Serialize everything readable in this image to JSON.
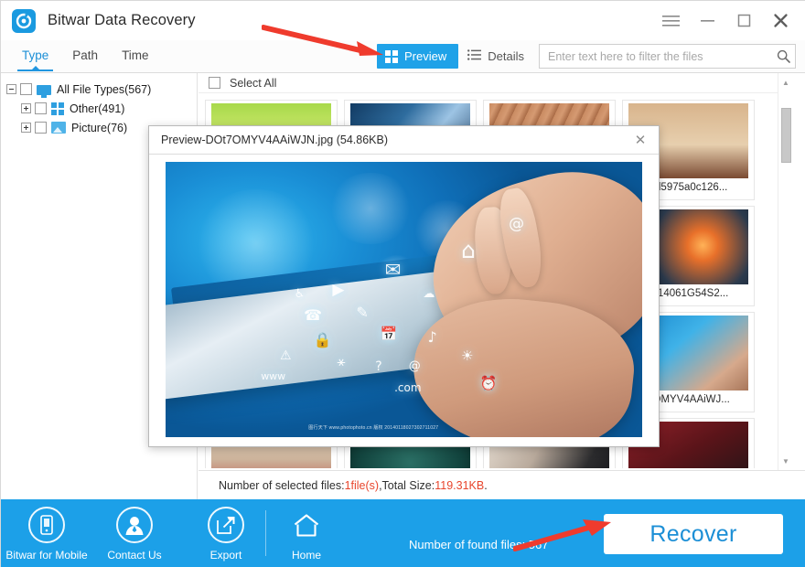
{
  "window": {
    "title": "Bitwar Data Recovery",
    "logo_icon": "bitwar-refresh-logo",
    "controls": [
      {
        "name": "menu",
        "icon": "hamburger-icon",
        "glyph": "☰"
      },
      {
        "name": "minimize",
        "icon": "minimize-icon",
        "glyph": "—"
      },
      {
        "name": "maximize",
        "icon": "maximize-icon",
        "glyph": "□"
      },
      {
        "name": "close",
        "icon": "close-icon",
        "glyph": "✕"
      }
    ]
  },
  "tabs": [
    {
      "label": "Type",
      "active": true
    },
    {
      "label": "Path",
      "active": false
    },
    {
      "label": "Time",
      "active": false
    }
  ],
  "toolbar": {
    "preview_label": "Preview",
    "preview_icon": "grid-view-icon",
    "details_label": "Details",
    "details_icon": "list-view-icon",
    "search_placeholder": "Enter text here to filter the files",
    "search_value": "",
    "search_icon": "search-icon",
    "accent_color": "#1fa2e8"
  },
  "tree": [
    {
      "label": "All File Types(567)",
      "level": 1,
      "icon": "monitor-icon",
      "expander": "minus",
      "checked": false
    },
    {
      "label": "Other(491)",
      "level": 2,
      "icon": "other-files-icon",
      "expander": "plus",
      "checked": false
    },
    {
      "label": "Picture(76)",
      "level": 2,
      "icon": "picture-icon",
      "expander": "plus",
      "checked": false
    }
  ],
  "file_grid": {
    "select_all_label": "Select All",
    "select_all_checked": false,
    "items": [
      {
        "name": "",
        "thumb": "grass-field"
      },
      {
        "name": "",
        "thumb": "skyscrapers"
      },
      {
        "name": "",
        "thumb": "brick-corridor"
      },
      {
        "name": "5d5975a0c126...",
        "thumb": "bread-board"
      },
      {
        "name": "",
        "thumb": "hands-device"
      },
      {
        "name": "",
        "thumb": "desk-laptop"
      },
      {
        "name": "",
        "thumb": "maze-pattern"
      },
      {
        "name": "0-14061G54S2...",
        "thumb": "bokeh-lights"
      },
      {
        "name": "",
        "thumb": "dark-scene"
      },
      {
        "name": "",
        "thumb": "blue-abstract"
      },
      {
        "name": "",
        "thumb": "office-desk"
      },
      {
        "name": "7OMYV4AAiWJ...",
        "thumb": "tablet-hands-blue"
      },
      {
        "name": "",
        "thumb": "red-ornaments"
      },
      {
        "name": "",
        "thumb": "teal-clock"
      },
      {
        "name": "",
        "thumb": "phones-flatlay"
      },
      {
        "name": "",
        "thumb": "red-phone"
      }
    ]
  },
  "status": {
    "prefix": "Number of selected files: ",
    "count": "1file(s)",
    "middle": " ,Total Size: ",
    "size": "119.31KB",
    "suffix": "."
  },
  "scrollbar": {
    "up_glyph": "▲",
    "down_glyph": "▼"
  },
  "preview_dialog": {
    "title": "Preview-DOt7OMYV4AAiWJN.jpg (54.86KB)",
    "close_glyph": "✕",
    "image_alt": "hands-holding-tablet-with-app-icons",
    "watermark": "图行天下  www.photophoto.cn  版权 20140118027302711027",
    "glyphs": [
      "✉",
      "⌂",
      "✎",
      "☎",
      "▶",
      "♪",
      "☁",
      "⚿",
      "ⓘ",
      "@",
      "?",
      ".com",
      "www"
    ]
  },
  "bottom_bar": {
    "background": "#1ca0e8",
    "items": [
      {
        "label": "Bitwar for Mobile",
        "icon": "mobile-phone-icon"
      },
      {
        "label": "Contact Us",
        "icon": "person-icon"
      },
      {
        "label": "Export",
        "icon": "export-arrow-icon"
      },
      {
        "label": "Home",
        "icon": "home-icon"
      }
    ],
    "found_files_label": "Number of found files: 567",
    "recover_label": "Recover"
  },
  "annotations": {
    "arrow_color": "#ef3b2d",
    "top_arrow_target": "Preview",
    "bottom_arrow_target": "Recover"
  }
}
